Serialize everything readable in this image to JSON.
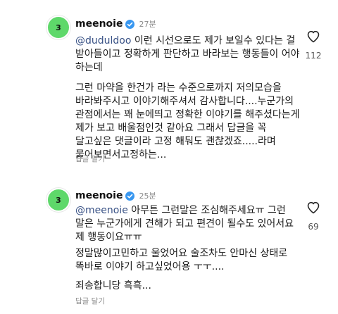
{
  "comments": [
    {
      "avatar_text": "3",
      "username": "meenoie",
      "time": "27분",
      "mention": "@duduldoo",
      "lines": [
        "이런 시선으로도 제가 보일수 있다는 걸 받아들이고 정확하게 판단하고 바라보는 행동들이 어야 하는데",
        "그런 마약을 한건가 라는 수준으로까지 저의모습을 바라봐주시고 이야기해주셔서 감사합니다....누군가의 관점에서는 꽤 눈에띄고 정확한 이야기를 해주셨다는게 제가 보고 배울점인것 같아요 그래서 답글을 꼭 달고싶은 댓글이라 고정 해둬도 괜찮겠죠.....라며 물어보면서고정하는..."
      ],
      "reply_label": "답글 달기",
      "like_count": "112"
    },
    {
      "avatar_text": "3",
      "username": "meenoie",
      "time": "25분",
      "mention": "@meenoie",
      "lines": [
        "아무튼 그런말은 조심해주세요ㅠ 그런 말은 누군가에게 견해가 되고 편견이 될수도 있어서요 제 행동이요ㅠㅠ",
        "정말많이고민하고 울었어요 술조차도 안마신 상태로 똑바로 이야기 하고싶었어용 ㅜㅜ....",
        "죄송합니당 흑흑..."
      ],
      "reply_label": "답글 달기",
      "like_count": "69"
    }
  ],
  "colors": {
    "avatar_bg": "#5ed86a",
    "verified": "#3897f0",
    "mention": "#385185",
    "muted": "#8a8a8a"
  },
  "icons": [
    "verified-badge-icon",
    "heart-icon"
  ]
}
